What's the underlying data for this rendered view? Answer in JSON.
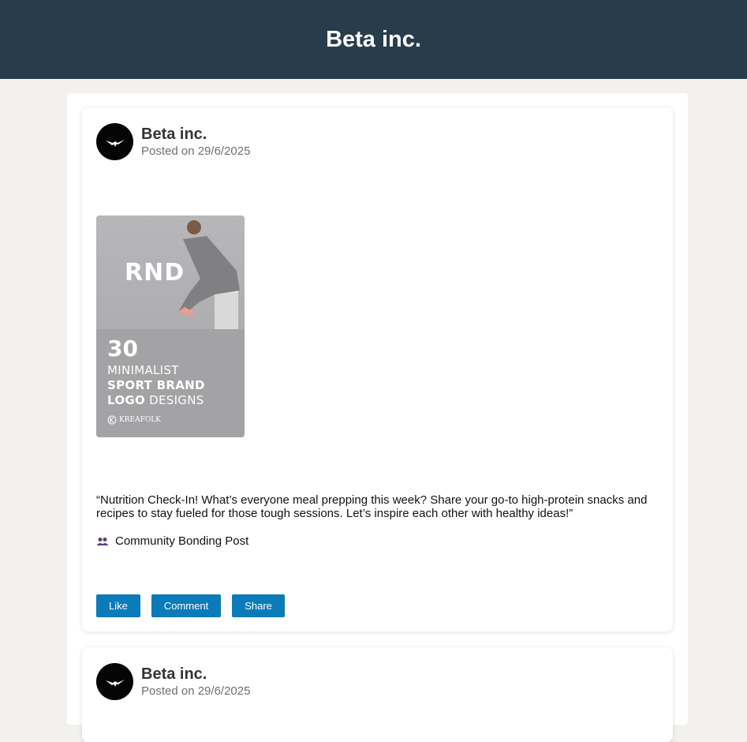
{
  "header": {
    "title": "Beta inc."
  },
  "posts": [
    {
      "author": "Beta inc.",
      "date": "Posted on 29/6/2025",
      "image": {
        "brand": "RND",
        "number": "30",
        "line1": "MINIMALIST",
        "line2": "SPORT BRAND",
        "line3_bold": "LOGO",
        "line3_rest": " DESIGNS",
        "credit": "KREAFOLK"
      },
      "text": "“Nutrition Check-In! What’s everyone meal prepping this week? Share your go-to high-protein snacks and recipes to stay fueled for those tough sessions. Let’s inspire each other with healthy ideas!”",
      "tag": "Community Bonding Post",
      "actions": {
        "like": "Like",
        "comment": "Comment",
        "share": "Share"
      }
    },
    {
      "author": "Beta inc.",
      "date": "Posted on 29/6/2025"
    }
  ],
  "colors": {
    "header_bg": "#283d4b",
    "button": "#0b7ab8",
    "tag_icon": "#5a3f7a"
  }
}
